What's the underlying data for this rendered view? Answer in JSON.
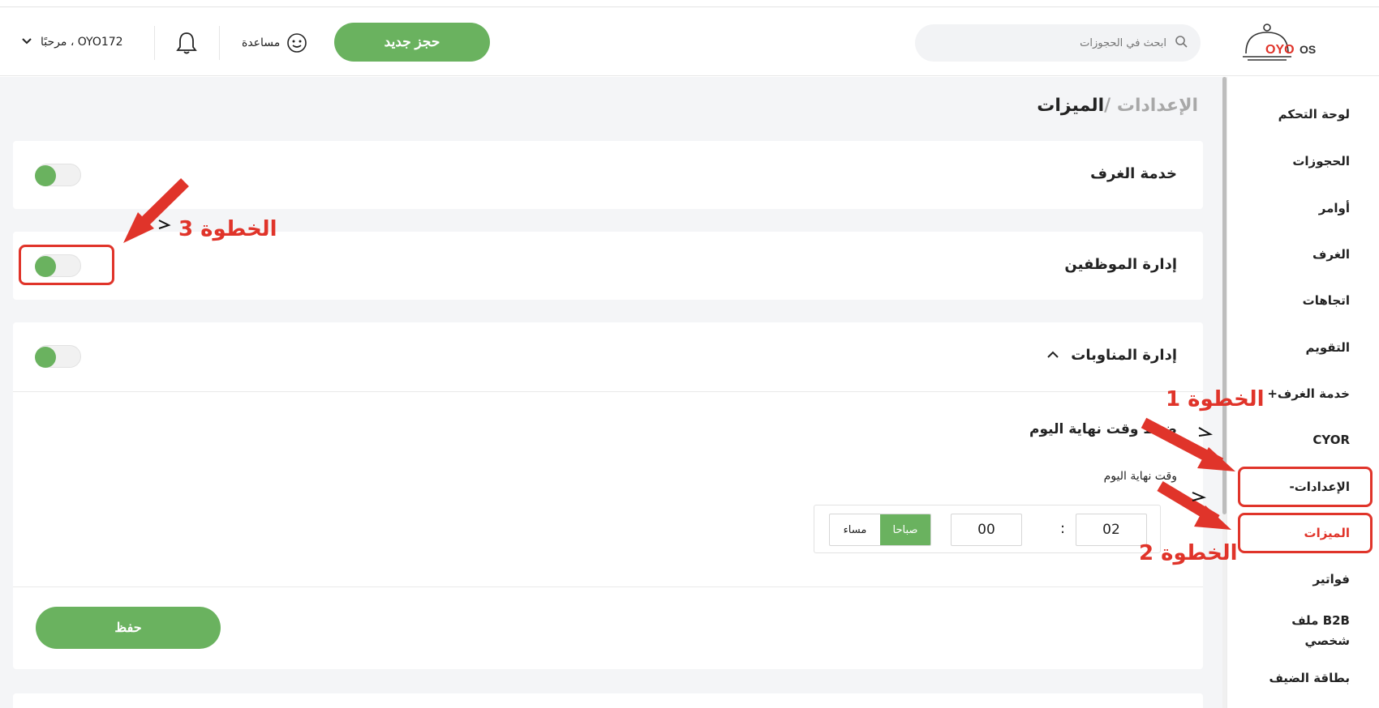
{
  "header": {
    "greeting": "مرحبًا ، OYO172",
    "help_label": "مساعدة",
    "new_booking_label": "حجز جديد",
    "search_placeholder": "ابحث في الحجوزات",
    "logo_text_oyo": "OYO",
    "logo_text_os": "OS"
  },
  "sidebar": {
    "items": [
      {
        "label": "لوحة التحكم"
      },
      {
        "label": "الحجوزات"
      },
      {
        "label": "أوامر"
      },
      {
        "label": "الغرف"
      },
      {
        "label": "اتجاهات"
      },
      {
        "label": "التقويم"
      },
      {
        "label": "خدمة الغرف+"
      },
      {
        "label": "CYOR"
      },
      {
        "label": "الإعدادات-"
      },
      {
        "label": "الميزات"
      },
      {
        "label": "فواتير"
      },
      {
        "label": "B2B ملف شخصي"
      },
      {
        "label": "بطاقة الضيف"
      }
    ],
    "active_index": 9
  },
  "breadcrumb": {
    "parent": "الإعدادات /",
    "current": "الميزات"
  },
  "features": {
    "room_service": {
      "title": "خدمة الغرف",
      "enabled": true
    },
    "staff_management": {
      "title": "إدارة الموظفين",
      "enabled": true
    },
    "shift_management": {
      "title": "إدارة المناوبات",
      "enabled": true,
      "expanded": true,
      "section_title": "ضبط وقت نهاية اليوم",
      "field_label": "وقت نهاية اليوم",
      "hour": "02",
      "minute": "00",
      "separator": ":",
      "am_label": "صباحا",
      "pm_label": "مساء",
      "selected_period": "am",
      "save_label": "حفظ"
    }
  },
  "annotations": {
    "step1": "الخطوة 1",
    "step2": "الخطوة 2",
    "step3": "الخطوة 3"
  },
  "colors": {
    "accent_green": "#6ab25f",
    "annotation_red": "#e0342a",
    "active_nav_red": "#e0342a"
  }
}
